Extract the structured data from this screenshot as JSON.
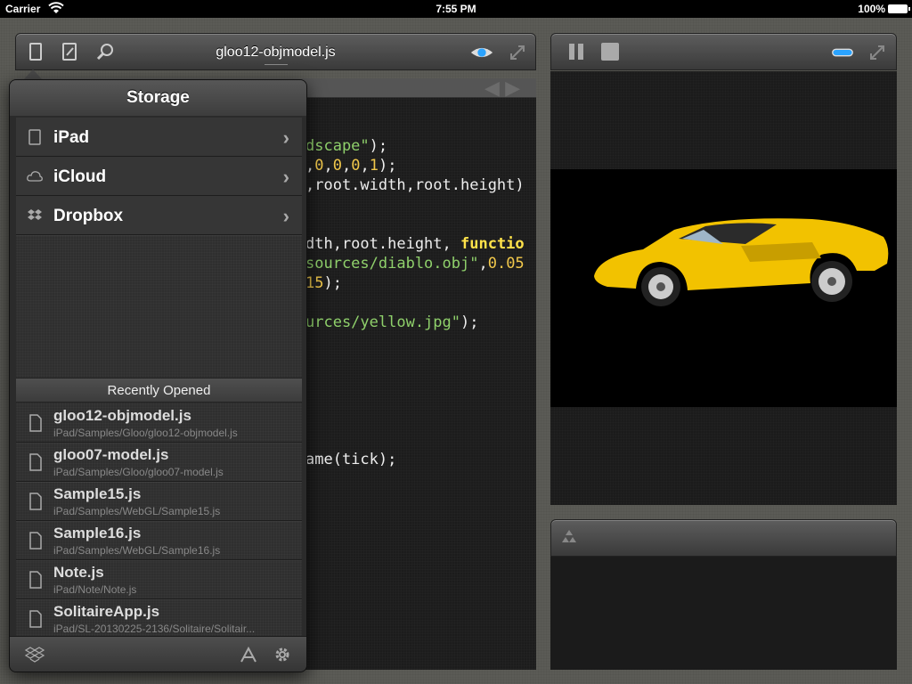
{
  "status_bar": {
    "carrier": "Carrier",
    "time": "7:55 PM",
    "battery": "100%"
  },
  "editor": {
    "title": "gloo12-objmodel.js",
    "code_lines": [
      {
        "parts": [
          {
            "t": "dscape\"",
            "c": "str"
          },
          {
            "t": ");",
            "c": ""
          }
        ]
      },
      {
        "parts": [
          {
            "t": ",",
            "c": ""
          },
          {
            "t": "0",
            "c": "num"
          },
          {
            "t": ",",
            "c": ""
          },
          {
            "t": "0",
            "c": "num"
          },
          {
            "t": ",",
            "c": ""
          },
          {
            "t": "0",
            "c": "num"
          },
          {
            "t": ",",
            "c": ""
          },
          {
            "t": "1",
            "c": "num"
          },
          {
            "t": ");",
            "c": ""
          }
        ]
      },
      {
        "parts": [
          {
            "t": ",root.width,root.height)",
            "c": ""
          }
        ]
      },
      {
        "parts": [
          {
            "t": "dth,root.height, ",
            "c": ""
          },
          {
            "t": "functio",
            "c": "kw"
          }
        ]
      },
      {
        "parts": [
          {
            "t": "sources/diablo.obj\"",
            "c": "str"
          },
          {
            "t": ",",
            "c": ""
          },
          {
            "t": "0.05",
            "c": "num"
          }
        ]
      },
      {
        "parts": [
          {
            "t": "15",
            "c": "num"
          },
          {
            "t": ");",
            "c": ""
          }
        ]
      },
      {
        "parts": [
          {
            "t": "urces/yellow.jpg\"",
            "c": "str"
          },
          {
            "t": ");",
            "c": ""
          }
        ]
      },
      {
        "parts": [
          {
            "t": "ame(tick);",
            "c": ""
          }
        ]
      }
    ]
  },
  "storage_popover": {
    "title": "Storage",
    "locations": [
      {
        "label": "iPad",
        "icon": "ipad-icon"
      },
      {
        "label": "iCloud",
        "icon": "cloud-icon"
      },
      {
        "label": "Dropbox",
        "icon": "dropbox-icon"
      }
    ],
    "recent_header": "Recently Opened",
    "recent_files": [
      {
        "name": "gloo12-objmodel.js",
        "path": "iPad/Samples/Gloo/gloo12-objmodel.js"
      },
      {
        "name": "gloo07-model.js",
        "path": "iPad/Samples/Gloo/gloo07-model.js"
      },
      {
        "name": "Sample15.js",
        "path": "iPad/Samples/WebGL/Sample15.js"
      },
      {
        "name": "Sample16.js",
        "path": "iPad/Samples/WebGL/Sample16.js"
      },
      {
        "name": "Note.js",
        "path": "iPad/Note/Note.js"
      },
      {
        "name": "SolitaireApp.js",
        "path": "iPad/SL-20130225-2136/Solitaire/Solitair..."
      }
    ]
  },
  "colors": {
    "car": "#f2c200",
    "preview_eye": "#2aa3ff"
  }
}
